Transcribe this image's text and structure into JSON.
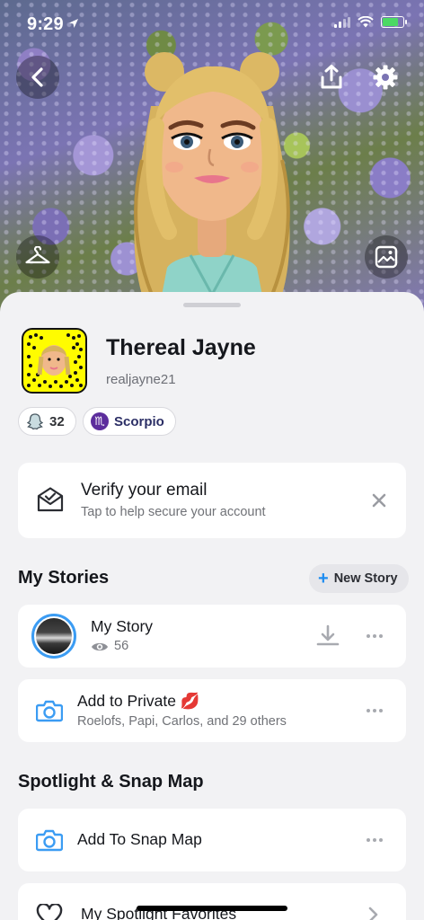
{
  "status_bar": {
    "time": "9:29"
  },
  "profile": {
    "display_name": "Thereal Jayne",
    "username": "realjayne21",
    "snap_score": "32",
    "zodiac": "Scorpio",
    "zodiac_glyph": "♏"
  },
  "verify_card": {
    "title": "Verify your email",
    "subtitle": "Tap to help secure your account"
  },
  "my_stories": {
    "section_title": "My Stories",
    "new_story_label": "New Story",
    "items": [
      {
        "title": "My Story",
        "views": "56"
      },
      {
        "title": "Add to Private 💋",
        "subtitle": "Roelofs, Papi, Carlos, and 29 others"
      }
    ]
  },
  "spotlight": {
    "section_title": "Spotlight & Snap Map",
    "items": [
      {
        "title": "Add To Snap Map"
      },
      {
        "title": "My Spotlight Favorites"
      }
    ]
  },
  "colors": {
    "accent_blue": "#3b9cf3",
    "snap_yellow": "#fffc00",
    "zodiac_purple": "#5c2d9c"
  }
}
